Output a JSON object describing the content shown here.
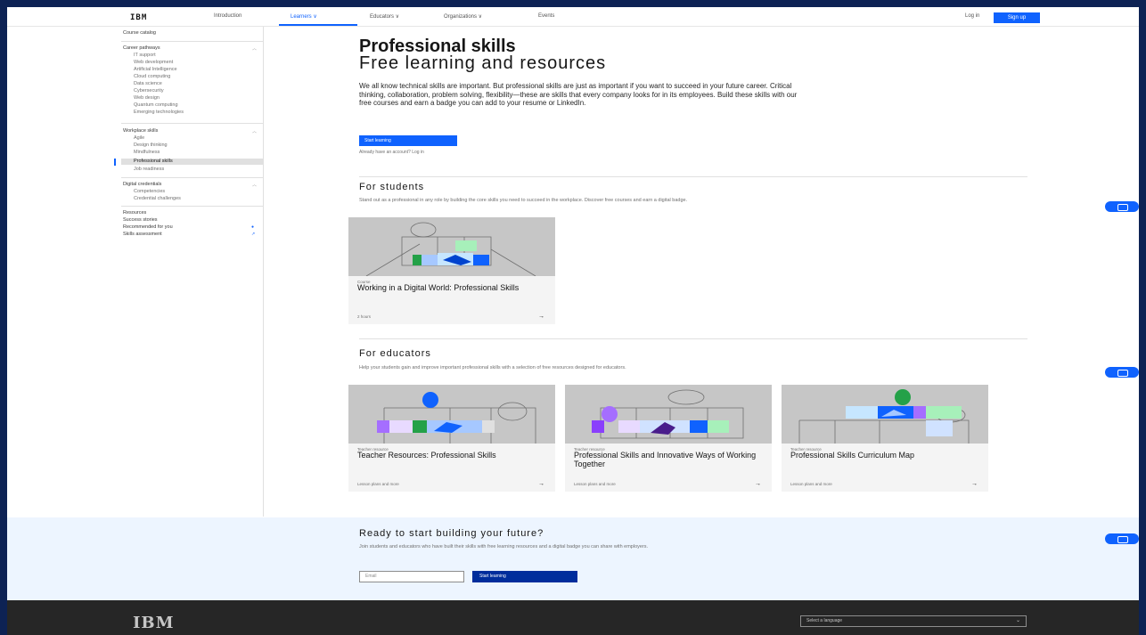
{
  "nav": {
    "logo": "IBM",
    "items": [
      {
        "label": "Introduction"
      },
      {
        "label": "Learners ∨"
      },
      {
        "label": "Educators ∨"
      },
      {
        "label": "Organizations ∨"
      },
      {
        "label": "Events"
      }
    ],
    "login": "Log in",
    "signup": "Sign up"
  },
  "sidebar": {
    "items": [
      {
        "label": "Course catalog"
      },
      {
        "label": "Career pathways"
      },
      {
        "label": "IT support"
      },
      {
        "label": "Web development"
      },
      {
        "label": "Artificial Intelligence"
      },
      {
        "label": "Cloud computing"
      },
      {
        "label": "Data science"
      },
      {
        "label": "Cybersecurity"
      },
      {
        "label": "Web design"
      },
      {
        "label": "Quantum computing"
      },
      {
        "label": "Emerging technologies"
      },
      {
        "label": "Workplace skills"
      },
      {
        "label": "Agile"
      },
      {
        "label": "Design thinking"
      },
      {
        "label": "Mindfulness"
      },
      {
        "label": "Professional skills"
      },
      {
        "label": "Job readiness"
      },
      {
        "label": "Digital credentials"
      },
      {
        "label": "Competencies"
      },
      {
        "label": "Credential challenges"
      },
      {
        "label": "Resources"
      },
      {
        "label": "Success stories"
      },
      {
        "label": "Recommended for you"
      },
      {
        "label": "Skills assessment"
      }
    ]
  },
  "main": {
    "title": "Professional skills",
    "subtitle": "Free learning and resources",
    "intro": "We all know technical skills are important. But professional skills are just as important if you want to succeed in your future career. Critical thinking, collaboration, problem solving, flexibility—these are skills that every company looks for in its employees. Build these skills with our free courses and earn a badge you can add to your resume or LinkedIn.",
    "primary_button": "Start learning",
    "sublink": "Already have an account? Log in",
    "students": {
      "title": "For students",
      "description": "Stand out as a professional in any role by building the core skills you need to succeed in the workplace. Discover free courses and earn a digital badge.",
      "cards": [
        {
          "kicker": "Course",
          "title": "Working in a Digital World: Professional Skills",
          "foot": "2 hours"
        }
      ]
    },
    "educators": {
      "title": "For educators",
      "description": "Help your students gain and improve important professional skills with a selection of free resources designed for educators.",
      "cards": [
        {
          "kicker": "Teacher resource",
          "title": "Teacher Resources: Professional Skills",
          "foot": "Lesson plans and more"
        },
        {
          "kicker": "Teacher resource",
          "title": "Professional Skills and Innovative Ways of Working Together",
          "foot": "Lesson plans and more"
        },
        {
          "kicker": "Teacher resource",
          "title": "Professional Skills Curriculum Map",
          "foot": "Lesson plans and more"
        }
      ]
    }
  },
  "cta": {
    "title": "Ready to start building your future?",
    "description": "Join students and educators who have built their skills with free learning resources and a digital badge you can share with employers.",
    "input_placeholder": "Email",
    "button": "Start learning"
  },
  "footer": {
    "logo": "IBM",
    "language": "Select a language"
  },
  "colors": {
    "accent": "#0f62fe",
    "frame": "#0d2254",
    "cta_bg": "#edf5ff",
    "footer_bg": "#262626"
  }
}
